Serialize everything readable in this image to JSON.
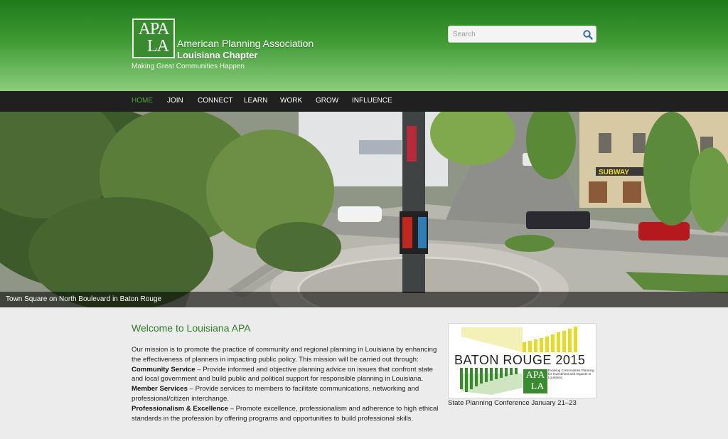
{
  "header": {
    "logo_top": "APA",
    "logo_bottom": "LA",
    "org_name": "American Planning Association",
    "org_chapter": "Louisiana Chapter",
    "tagline": "Making Great Communities Happen",
    "search": {
      "placeholder": "Search",
      "value": ""
    }
  },
  "nav": {
    "items": [
      {
        "label": "HOME",
        "active": true
      },
      {
        "label": "JOIN"
      },
      {
        "label": "CONNECT"
      },
      {
        "label": "LEARN"
      },
      {
        "label": "WORK"
      },
      {
        "label": "GROW"
      },
      {
        "label": "INFLUENCE"
      }
    ]
  },
  "hero": {
    "caption": "Town Square on North Boulevard in Baton Rouge",
    "sign_text": "SUBWAY"
  },
  "main": {
    "welcome_title": "Welcome to Louisiana APA",
    "intro": "Our mission is to promote the practice of community and regional planning in Louisiana by enhancing the effectiveness of planners in impacting public policy. This mission will be carried out through:",
    "items": [
      {
        "label": "Community Service",
        "text": " – Provide informed and objective planning advice on issues that confront state and local government and build public and political support for responsible planning in Louisiana."
      },
      {
        "label": "Member Services",
        "text": " – Provide services to members to facilitate communications, networking and professional/citizen interchange."
      },
      {
        "label": "Professionalism & Excellence",
        "text": " – Promote excellence, professionalism and adherence to high ethical standards in the profession by offering programs and opportunities to build professional skills."
      }
    ]
  },
  "sidebar": {
    "conference_title": "BATON ROUGE 2015",
    "conference_sub": "Evolving Communities Planning for Investment and Impacts in Louisiana",
    "logo_top": "APA",
    "logo_bottom": "LA",
    "conference_caption": "State Planning Conference January 21–23"
  },
  "colors": {
    "header_green": "#1f7a1c",
    "header_light": "#8ccc7e",
    "nav_bg": "#202020",
    "nav_active": "#4fa843",
    "title_green": "#2f7d26",
    "conf_yellow": "#e5e02a"
  },
  "icons": {
    "search": "search-icon"
  }
}
